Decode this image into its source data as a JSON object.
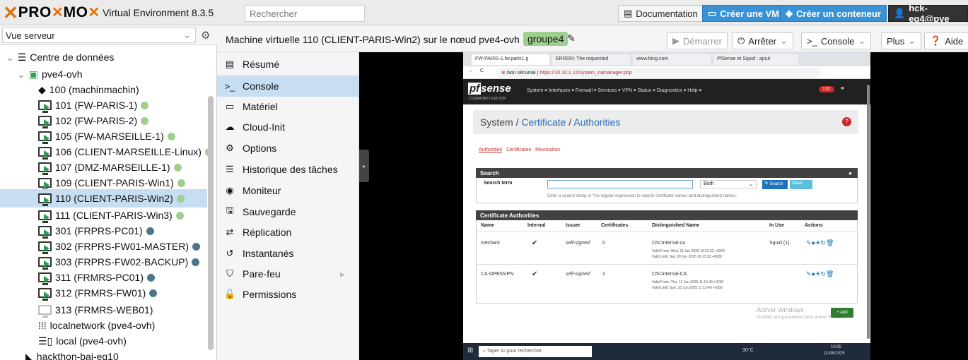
{
  "topbar": {
    "logo_pro": "PRO",
    "logo_mo": "MO",
    "version_text": "Virtual Environment 8.3.5",
    "search_placeholder": "Rechercher",
    "documentation": "Documentation",
    "create_vm": "Créer une VM",
    "create_ct": "Créer un conteneur",
    "user": "hck-eq4@pve"
  },
  "tree_header": {
    "view": "Vue serveur"
  },
  "tree": [
    {
      "label": "Centre de données",
      "icon": "datacenter-icon"
    },
    {
      "label": "pve4-ovh",
      "icon": "node-icon"
    },
    {
      "label": "100 (machinmachin)",
      "icon": "container-icon"
    },
    {
      "label": "101 (FW-PARIS-1)",
      "icon": "vm-icon",
      "status": "green"
    },
    {
      "label": "102 (FW-PARIS-2)",
      "icon": "vm-icon",
      "status": "green"
    },
    {
      "label": "105 (FW-MARSEILLE-1)",
      "icon": "vm-icon",
      "status": "green"
    },
    {
      "label": "106 (CLIENT-MARSEILLE-Linux)",
      "icon": "vm-icon",
      "status": "green"
    },
    {
      "label": "107 (DMZ-MARSEILLE-1)",
      "icon": "vm-icon",
      "status": "green"
    },
    {
      "label": "109 (CLIENT-PARIS-Win1)",
      "icon": "vm-icon",
      "status": "green"
    },
    {
      "label": "110 (CLIENT-PARIS-Win2)",
      "icon": "vm-icon",
      "status": "green",
      "selected": true
    },
    {
      "label": "111 (CLIENT-PARIS-Win3)",
      "icon": "vm-icon",
      "status": "green"
    },
    {
      "label": "301 (FRPRS-PC01)",
      "icon": "vm-icon",
      "status": "blue"
    },
    {
      "label": "302 (FRPRS-FW01-MASTER)",
      "icon": "vm-icon",
      "status": "blue"
    },
    {
      "label": "303 (FRPRS-FW02-BACKUP)",
      "icon": "vm-icon",
      "status": "blue"
    },
    {
      "label": "311 (FRMRS-PC01)",
      "icon": "vm-icon",
      "status": "blue"
    },
    {
      "label": "312 (FRMRS-FW01)",
      "icon": "vm-icon",
      "status": "blue"
    },
    {
      "label": "313 (FRMRS-WEB01)",
      "icon": "vm-stopped-icon"
    },
    {
      "label": "localnetwork (pve4-ovh)",
      "icon": "network-icon"
    },
    {
      "label": "local (pve4-ovh)",
      "icon": "storage-icon"
    },
    {
      "label": "hackthon-bai-eq10",
      "icon": "pool-icon"
    }
  ],
  "content_header": {
    "title": "Machine virtuelle 110 (CLIENT-PARIS-Win2) sur le nœud pve4-ovh",
    "tag": "groupe4",
    "start": "Démarrer",
    "stop": "Arrêter",
    "console": "Console",
    "more": "Plus",
    "help": "Aide"
  },
  "menu": [
    {
      "label": "Résumé",
      "icon": "▤"
    },
    {
      "label": "Console",
      "icon": ">_",
      "selected": true
    },
    {
      "label": "Matériel",
      "icon": "▭"
    },
    {
      "label": "Cloud-Init",
      "icon": "☁"
    },
    {
      "label": "Options",
      "icon": "⚙"
    },
    {
      "label": "Historique des tâches",
      "icon": "☰"
    },
    {
      "label": "Moniteur",
      "icon": "◉"
    },
    {
      "label": "Sauvegarde",
      "icon": "🖫"
    },
    {
      "label": "Réplication",
      "icon": "⇄"
    },
    {
      "label": "Instantanés",
      "icon": "↺"
    },
    {
      "label": "Pare-feu",
      "icon": "⛉"
    },
    {
      "label": "Permissions",
      "icon": "🔓"
    }
  ],
  "browser": {
    "tabs": [
      "FW-PARIS-1.fw.paris1.g",
      "ERROR: The requested",
      "www.bing.com",
      "PfSense et Squid : ajout"
    ],
    "insecure": "Non sécurisé",
    "url": "https://10.10.1.10/system_camanager.php"
  },
  "pfsense": {
    "logo": "sense",
    "logo_pf": "pf",
    "edition": "COMMUNITY EDITION",
    "menu": "System ▾   Interfaces ▾   Firewall ▾   Services ▾   VPN ▾   Status ▾   Diagnostics ▾   Help ▾",
    "badge": "132",
    "breadcrumb_system": "System",
    "breadcrumb_cert": "Certificate",
    "breadcrumb_auth": "Authorities",
    "subtabs": [
      "Authorities",
      "Certificates",
      "Revocation"
    ],
    "search_title": "Search",
    "search_term": "Search term",
    "both": "Both",
    "search_btn": "Search",
    "clear_btn": "Clear",
    "search_hint": "Enter a search string or *nix regular expression to search certificate names and distinguished names.",
    "ca_title": "Certificate Authorities",
    "columns": [
      "Name",
      "Internal",
      "Issuer",
      "Certificates",
      "Distinguished Name",
      "In Use",
      "Actions"
    ],
    "rows": [
      {
        "name": "méchant",
        "internal": "✔",
        "issuer": "self-signed",
        "certs": "0",
        "dn": "CN=internal-ca",
        "from": "Valid From: Wed, 11 Jun 2025 16:23:32 +0200",
        "until": "Valid Until: Sat, 09 Jun 2035 16:23:32 +0200",
        "inuse": "Squid (1)"
      },
      {
        "name": "CA-OPENVPN",
        "internal": "✔",
        "issuer": "self-signed",
        "certs": "2",
        "dn": "CN=internal-CA",
        "from": "Valid From: Thu, 12 Jun 2025 11:13:49 +0200",
        "until": "Valid Until: Sun, 10 Jun 2035 11:13:49 +0200",
        "inuse": ""
      }
    ],
    "add": "Add",
    "watermark_title": "Activer Windows",
    "watermark_sub": "Accédez aux paramètres pour activer Windows."
  },
  "taskbar": {
    "search": "Taper ici pour rechercher",
    "temp": "30°C",
    "time": "10:05",
    "date": "11/06/2025"
  }
}
